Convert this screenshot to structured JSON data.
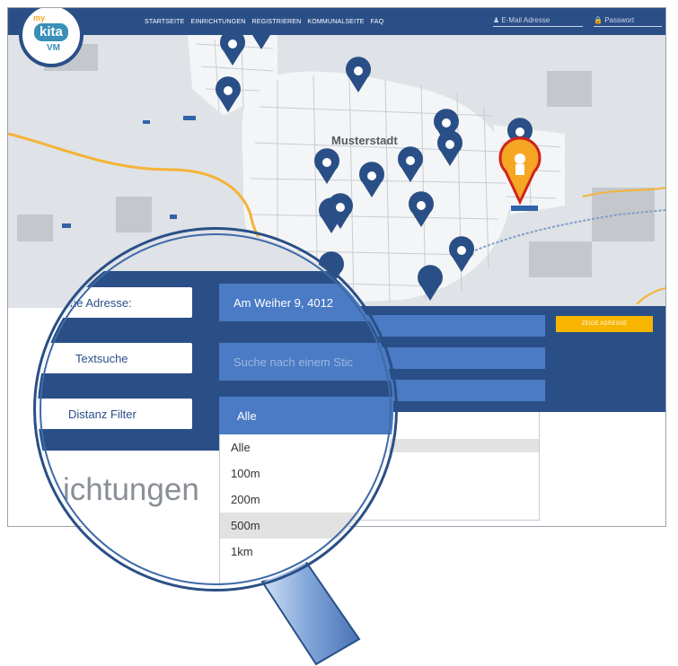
{
  "nav": {
    "links": [
      "STARTSEITE",
      "EINRICHTUNGEN",
      "REGISTRIEREN",
      "KOMMUNALSEITE",
      "FAQ"
    ],
    "email_placeholder": "E-Mail Adresse",
    "password_placeholder": "Passwort"
  },
  "logo": {
    "my": "my",
    "kita": "kita",
    "vm": "VM"
  },
  "map": {
    "city": "Musterstadt"
  },
  "panel": {
    "zeige_button": "ZEIGE ADRESSE"
  },
  "lens": {
    "address_label": "ne Adresse:",
    "address_value": "Am Weiher 9, 4012",
    "text_label": "Textsuche",
    "text_placeholder": "Suche nach einem Stic",
    "distance_label": "Distanz Filter",
    "distance_selected": "Alle",
    "options": [
      "Alle",
      "100m",
      "200m",
      "500m",
      "1km"
    ],
    "highlighted_option": "500m",
    "heading_fragment": "ichtungen"
  },
  "colors": {
    "primary": "#2a4f87",
    "input": "#4a7bc4",
    "accent": "#f7b500",
    "selected_marker": "#f5a623"
  }
}
